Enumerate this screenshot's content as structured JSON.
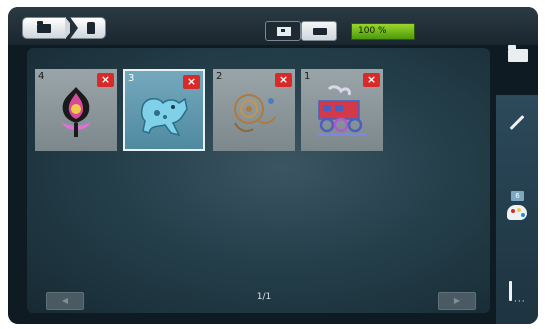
{
  "header": {
    "capacity": "100 %",
    "breadcrumb": [
      "folder",
      "file"
    ]
  },
  "designs": [
    {
      "number": "4",
      "delete_label": "×",
      "selected": false,
      "icon": "ornament-design"
    },
    {
      "number": "3",
      "delete_label": "×",
      "selected": true,
      "icon": "dog-design"
    },
    {
      "number": "2",
      "delete_label": "×",
      "selected": false,
      "icon": "rose-design"
    },
    {
      "number": "1",
      "delete_label": "×",
      "selected": false,
      "icon": "train-design"
    }
  ],
  "pager": {
    "indicator": "1/1",
    "prev_icon": "arrow-left-icon",
    "next_icon": "arrow-right-icon"
  },
  "sidebar": {
    "color_count": "6",
    "icons": [
      "folder-icon",
      "pen-icon",
      "palette-icon",
      "needle-icon"
    ]
  },
  "colors": {
    "capacity_bar": "#6cb81a",
    "delete": "#d92a2a",
    "selected_tile": "#5f96ac",
    "sidebar": "#25404e"
  }
}
